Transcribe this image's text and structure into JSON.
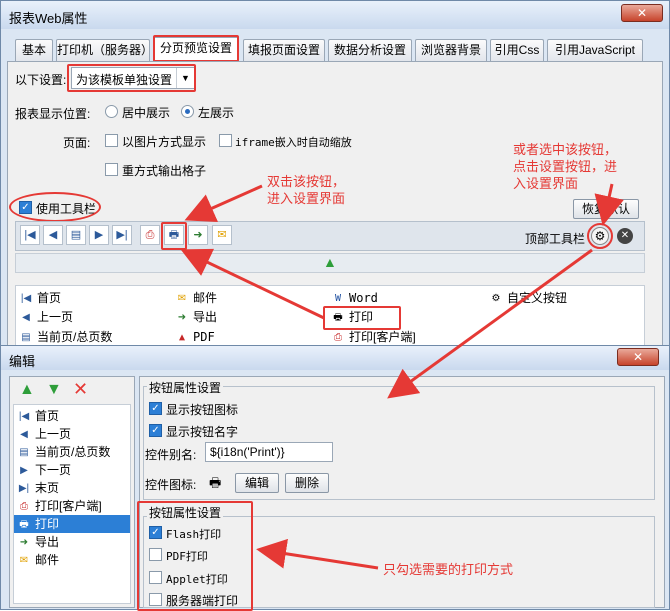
{
  "top_window": {
    "title": "报表Web属性",
    "close": "✕",
    "tabs": [
      "基本",
      "打印机（服务器）",
      "分页预览设置",
      "填报页面设置",
      "数据分析设置",
      "浏览器背景",
      "引用Css",
      "引用JavaScript"
    ],
    "active_tab": "分页预览设置",
    "settings_label": "以下设置:",
    "settings_value": "为该模板单独设置",
    "position_label": "报表显示位置:",
    "position_options": [
      "居中展示",
      "左展示"
    ],
    "position_selected": "左展示",
    "page_label": "页面:",
    "checkbox_image": "以图片方式显示",
    "checkbox_iframe": "iframe嵌入时自动缩放",
    "checkbox_repeat": "重方式输出格子",
    "use_toolbar": "使用工具栏",
    "restore_default": "恢复默认",
    "top_toolbar_label": "顶部工具栏",
    "buttons_grid": [
      [
        "首页",
        "邮件",
        "Word",
        "自定义按钮"
      ],
      [
        "上一页",
        "导出",
        "打印",
        ""
      ],
      [
        "当前页/总页数",
        "PDF",
        "打印[客户端]",
        ""
      ]
    ],
    "annotation_left": "双击该按钮，\n进入设置界面",
    "annotation_right": "或者选中该按钮，\n点击设置按钮，进\n入设置界面"
  },
  "edit_window": {
    "title": "编辑",
    "close": "✕",
    "list_items": [
      "首页",
      "上一页",
      "当前页/总页数",
      "下一页",
      "末页",
      "打印[客户端]",
      "打印",
      "导出",
      "邮件"
    ],
    "selected_item": "打印",
    "group1_title": "按钮属性设置",
    "show_icon": "显示按钮图标",
    "show_name": "显示按钮名字",
    "alias_label": "控件别名:",
    "alias_value": "${i18n('Print')}",
    "icon_label": "控件图标:",
    "edit_button": "编辑",
    "delete_button": "删除",
    "group2_title": "按钮属性设置",
    "print_options": [
      "Flash打印",
      "PDF打印",
      "Applet打印",
      "服务器端打印"
    ],
    "print_checked": [
      true,
      false,
      false,
      false
    ],
    "annotation": "只勾选需要的打印方式"
  },
  "colors": {
    "accent": "#e53935",
    "selection": "#2c7fd6",
    "frame": "#dbe6f3"
  }
}
